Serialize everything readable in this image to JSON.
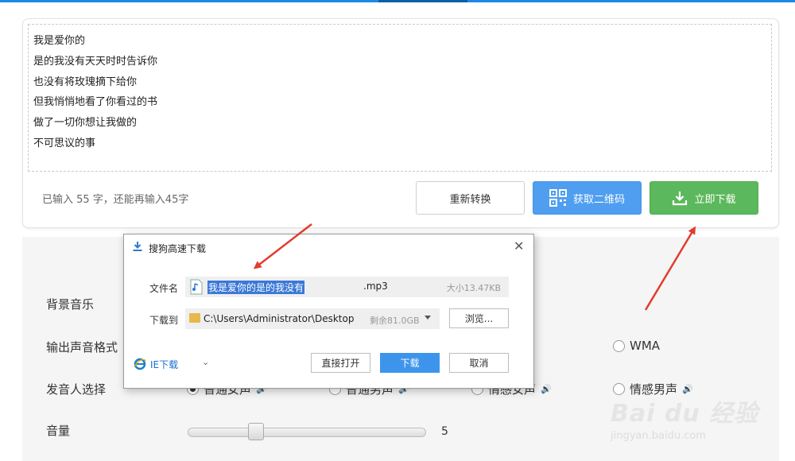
{
  "editor": {
    "lines": [
      "我是爱你的",
      "是的我没有天天时时告诉你",
      "也没有将玫瑰摘下给你",
      "但我悄悄地看了你看过的书",
      "做了一切你想让我做的",
      "不可思议的事"
    ],
    "counter": "已输入 55 字，还能再输入45字",
    "buttons": {
      "reconvert": "重新转换",
      "qr": "获取二维码",
      "download": "立即下载"
    }
  },
  "settings": {
    "bgm_label": "背景音乐",
    "format_label": "输出声音格式",
    "format_visible_option": "WMA",
    "speaker_label": "发音人选择",
    "speakers": [
      "普通女声",
      "普通男声",
      "情感女声",
      "情感男声"
    ],
    "speaker_selected": "普通女声",
    "volume_label": "音量",
    "volume_value": "5",
    "volume_level_fraction": 0.3
  },
  "dialog": {
    "title": "搜狗高速下载",
    "filename_label": "文件名",
    "filename_selected": "我是爱你的是的我没有",
    "filename_ext": ".mp3",
    "filesize": "大小13.47KB",
    "saveto_label": "下载到",
    "path": "C:\\Users\\Administrator\\Desktop",
    "free_space": "剩余81.0GB",
    "browse": "浏览...",
    "ie_download": "IE下载",
    "open_direct": "直接打开",
    "download": "下载",
    "cancel": "取消"
  },
  "watermark": {
    "logo": "Bai du 经验",
    "url": "jingyan.baidu.com"
  },
  "colors": {
    "accent": "#1e88e5",
    "qr_button": "#4f9ef0",
    "download_button": "#5cb85c",
    "annotation_arrow": "#e23c2e"
  }
}
